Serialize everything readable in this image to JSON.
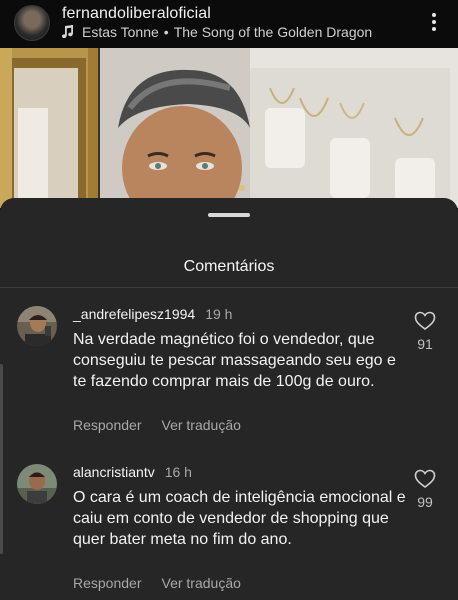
{
  "post": {
    "username": "fernandoliberaloficial",
    "audio_artist": "Estas Tonne",
    "audio_separator": "•",
    "audio_title": "The Song of the Golden Dragon",
    "icons": {
      "music": "music-note-icon",
      "more": "more-vertical-icon"
    }
  },
  "sheet": {
    "title": "Comentários"
  },
  "comments": [
    {
      "username": "_andrefelipesz1994",
      "time": "19 h",
      "text": "Na verdade magnético foi o vendedor, que conseguiu te pescar massageando seu ego e te fazendo comprar mais de 100g de ouro.",
      "reply_label": "Responder",
      "translate_label": "Ver tradução",
      "like_count": "91",
      "like_icon": "heart-icon"
    },
    {
      "username": "alancristiantv",
      "time": "16 h",
      "text": "O cara é um coach de inteligência emocional e caiu em conto de vendedor de shopping que quer bater meta no fim do ano.",
      "reply_label": "Responder",
      "translate_label": "Ver tradução",
      "like_count": "99",
      "like_icon": "heart-icon"
    }
  ],
  "colors": {
    "background": "#0a0a0a",
    "sheet": "#262626",
    "text_primary": "#f2f2f2",
    "text_secondary": "#a8a8a8"
  }
}
